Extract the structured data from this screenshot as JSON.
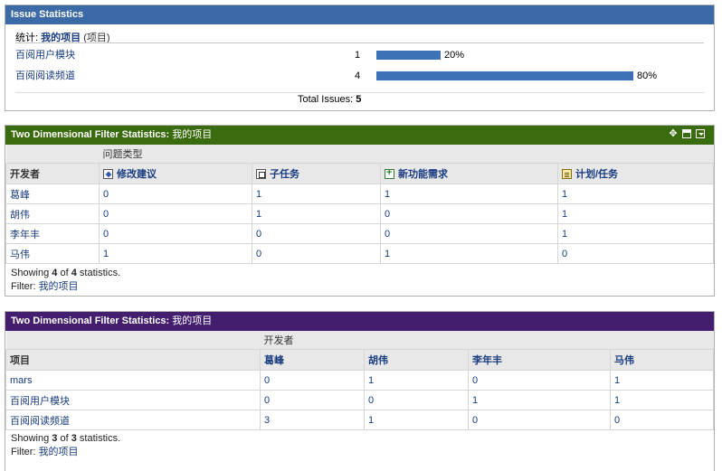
{
  "issue_stats": {
    "title": "Issue Statistics",
    "stat_prefix": "统计:",
    "stat_name": "我的项目",
    "stat_suffix": "(项目)",
    "rows": [
      {
        "name": "百阅用户模块",
        "count": "1",
        "percent": "20%",
        "fraction": 0.2
      },
      {
        "name": "百阅阅读频道",
        "count": "4",
        "percent": "80%",
        "fraction": 0.8
      }
    ],
    "total_label": "Total Issues:",
    "total_value": "5",
    "bar_color": "#3f71b6"
  },
  "filter1": {
    "title_prefix": "Two Dimensional Filter Statistics:",
    "title_name": "我的项目",
    "header_color": "#3b6b0f",
    "col_group_label": "问题类型",
    "row_header": "开发者",
    "columns": [
      {
        "label": "修改建议",
        "icon": "improvement-icon"
      },
      {
        "label": "子任务",
        "icon": "subtask-icon"
      },
      {
        "label": "新功能需求",
        "icon": "new-feature-icon"
      },
      {
        "label": "计划/任务",
        "icon": "task-icon"
      }
    ],
    "rows": [
      {
        "name": "葛峰",
        "values": [
          "0",
          "1",
          "1",
          "1"
        ]
      },
      {
        "name": "胡伟",
        "values": [
          "0",
          "1",
          "0",
          "1"
        ]
      },
      {
        "name": "李年丰",
        "values": [
          "0",
          "0",
          "0",
          "1"
        ]
      },
      {
        "name": "马伟",
        "values": [
          "1",
          "0",
          "1",
          "0"
        ]
      }
    ],
    "showing_prefix": "Showing",
    "showing_count": "4",
    "showing_of": "of",
    "showing_total": "4",
    "showing_suffix": "statistics.",
    "filter_label": "Filter:",
    "filter_name": "我的项目"
  },
  "filter2": {
    "title_prefix": "Two Dimensional Filter Statistics:",
    "title_name": "我的项目",
    "header_color": "#431e6e",
    "col_group_label": "开发者",
    "row_header": "项目",
    "columns": [
      "葛峰",
      "胡伟",
      "李年丰",
      "马伟"
    ],
    "rows": [
      {
        "name": "mars",
        "values": [
          "0",
          "1",
          "0",
          "1"
        ]
      },
      {
        "name": "百阅用户模块",
        "values": [
          "0",
          "0",
          "1",
          "1"
        ]
      },
      {
        "name": "百阅阅读频道",
        "values": [
          "3",
          "1",
          "0",
          "0"
        ]
      }
    ],
    "showing_prefix": "Showing",
    "showing_count": "3",
    "showing_of": "of",
    "showing_total": "3",
    "showing_suffix": "statistics.",
    "filter_label": "Filter:",
    "filter_name": "我的项目"
  }
}
